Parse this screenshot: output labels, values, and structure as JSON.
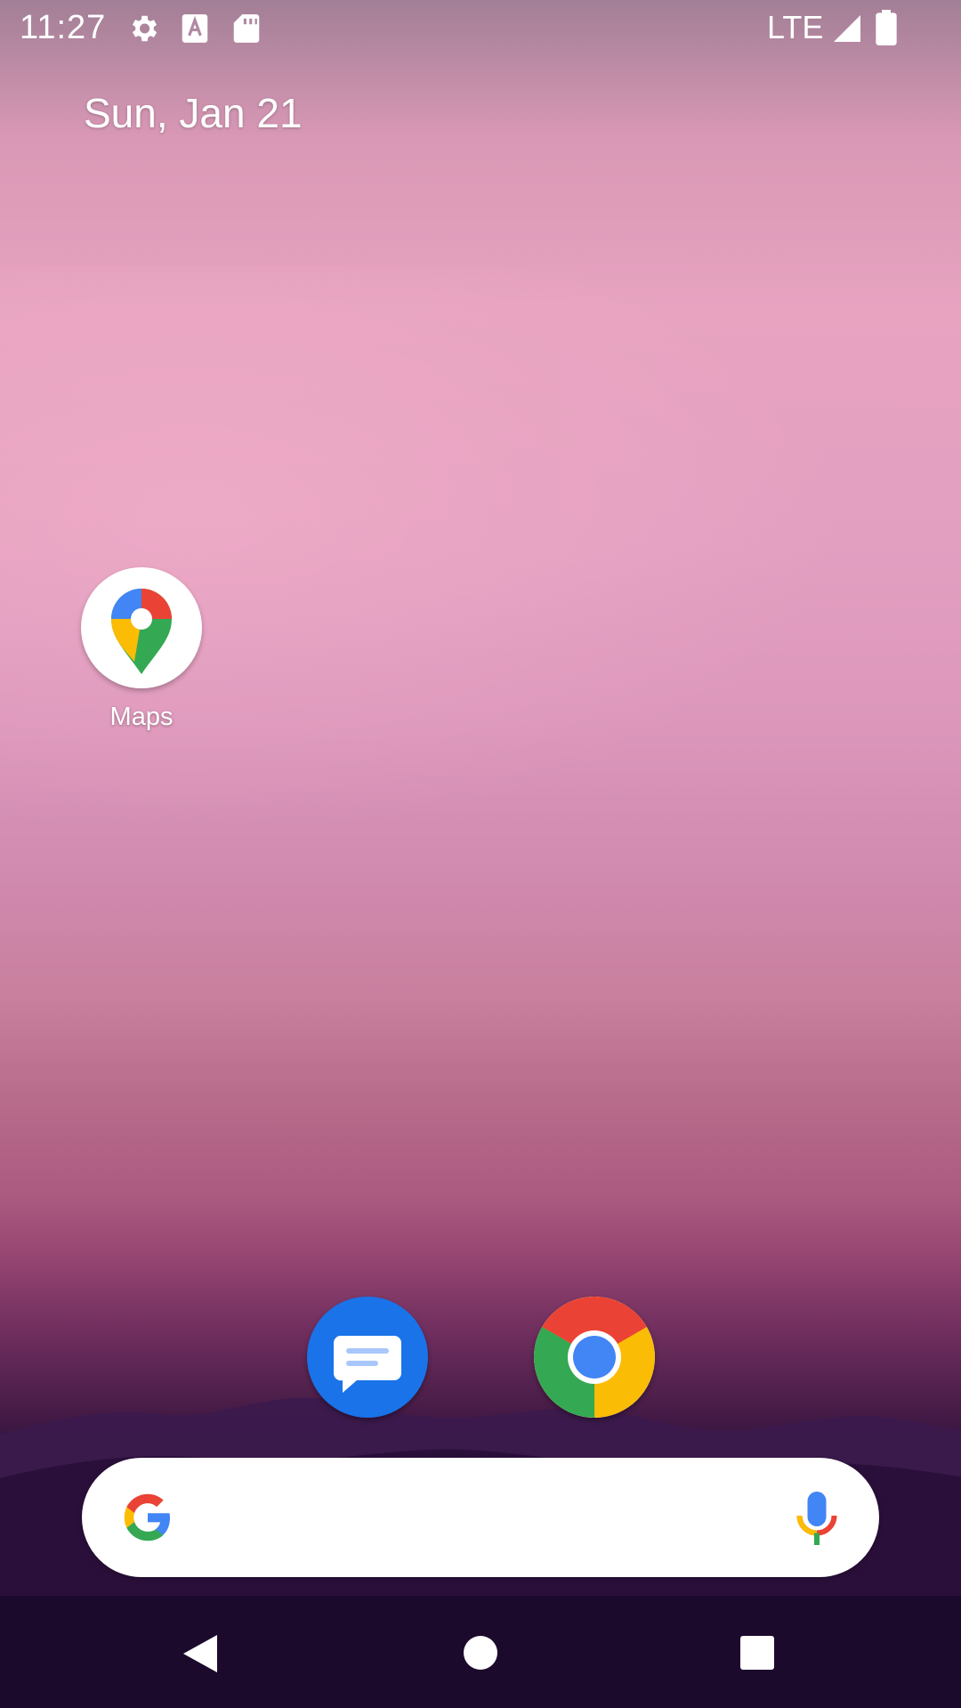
{
  "status_bar": {
    "time": "11:27",
    "icons": [
      "settings-icon",
      "text-a-icon",
      "sd-card-icon"
    ],
    "network": "LTE",
    "right_icons": [
      "signal-icon",
      "battery-icon"
    ]
  },
  "home": {
    "date": "Sun, Jan 21",
    "apps": [
      {
        "label": "Maps",
        "icon": "maps-icon"
      }
    ]
  },
  "dock": {
    "apps": [
      {
        "name": "Messages",
        "icon": "messages-icon"
      },
      {
        "name": "Chrome",
        "icon": "chrome-icon"
      }
    ]
  },
  "search_bar": {
    "left_icon": "google-g-icon",
    "right_icon": "microphone-icon"
  },
  "nav_bar": {
    "buttons": [
      "back-icon",
      "home-icon",
      "recents-icon"
    ]
  },
  "colors": {
    "messages_blue": "#1a73e8",
    "google_blue": "#4285f4",
    "google_red": "#ea4335",
    "google_yellow": "#fbbc05",
    "google_green": "#34a853"
  }
}
